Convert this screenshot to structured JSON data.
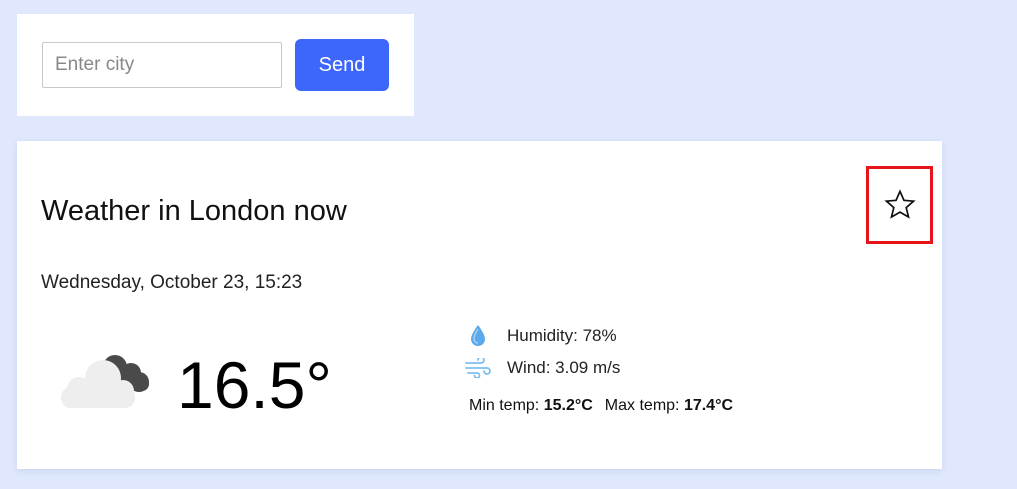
{
  "search": {
    "placeholder": "Enter city",
    "value": "",
    "send_label": "Send"
  },
  "weather": {
    "title": "Weather in London now",
    "date": "Wednesday, October 23, 15:23",
    "temperature": "16.5°",
    "condition_icon": "cloudy-icon",
    "humidity_label": "Humidity: 78%",
    "wind_label": "Wind: 3.09 m/s",
    "min_label": "Min temp:",
    "min_value": "15.2°C",
    "max_label": "Max temp:",
    "max_value": "17.4°C",
    "favorite_icon": "star-icon",
    "favorite_selected": false
  },
  "colors": {
    "page_background": "#dfe8fd",
    "send_button": "#3d66fb",
    "highlight_border": "#e8141c",
    "humidity_icon": "#5aa9ea",
    "wind_icon": "#7cc0ef"
  }
}
